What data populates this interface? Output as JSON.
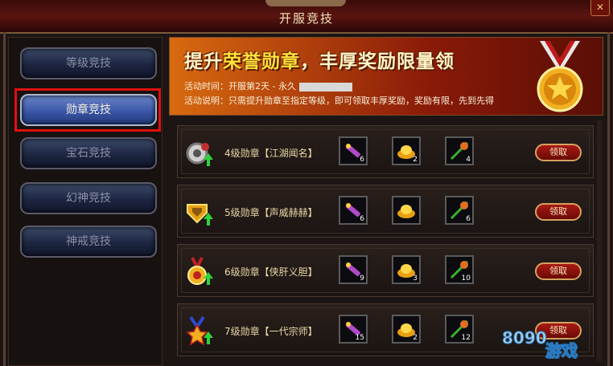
{
  "window": {
    "title": "开服竞技",
    "close_symbol": "✕"
  },
  "sidebar": {
    "items": [
      {
        "label": "等级竞技",
        "active": false
      },
      {
        "label": "勋章竞技",
        "active": true
      },
      {
        "label": "宝石竞技",
        "active": false
      },
      {
        "label": "幻神竞技",
        "active": false
      },
      {
        "label": "神戒竞技",
        "active": false
      }
    ]
  },
  "banner": {
    "headline_a": "提升",
    "headline_b": "荣誉勋章",
    "headline_c": "，丰厚奖励限量领",
    "time_label": "活动时间：",
    "time_value": "开服第2天 - 永久",
    "desc_label": "活动说明：",
    "desc_value": "只需提升勋章至指定等级，即可领取丰厚奖励，奖励有限，先到先得"
  },
  "rows": [
    {
      "label": "4级勋章【江湖闻名】",
      "items": [
        {
          "icon": "scroll-icon",
          "count": "6"
        },
        {
          "icon": "gold-ingot-icon",
          "count": "2"
        },
        {
          "icon": "herb-icon",
          "count": "4"
        }
      ],
      "button": "领取"
    },
    {
      "label": "5级勋章【声威赫赫】",
      "items": [
        {
          "icon": "scroll-icon",
          "count": "6"
        },
        {
          "icon": "gold-ingot-icon",
          "count": ""
        },
        {
          "icon": "herb-icon",
          "count": "6"
        }
      ],
      "button": "领取"
    },
    {
      "label": "6级勋章【侠肝义胆】",
      "items": [
        {
          "icon": "scroll-icon",
          "count": "9"
        },
        {
          "icon": "gold-ingot-icon",
          "count": "3"
        },
        {
          "icon": "herb-icon",
          "count": "10"
        }
      ],
      "button": "领取"
    },
    {
      "label": "7级勋章【一代宗师】",
      "items": [
        {
          "icon": "scroll-icon",
          "count": "15"
        },
        {
          "icon": "gold-ingot-icon",
          "count": "2"
        },
        {
          "icon": "herb-icon",
          "count": "12"
        }
      ],
      "button": "领取"
    }
  ],
  "watermark": {
    "logo": "8090",
    "text": "游戏"
  },
  "colors": {
    "accent": "#e01010",
    "banner": "#d86a10",
    "gold": "#ffe23a"
  }
}
